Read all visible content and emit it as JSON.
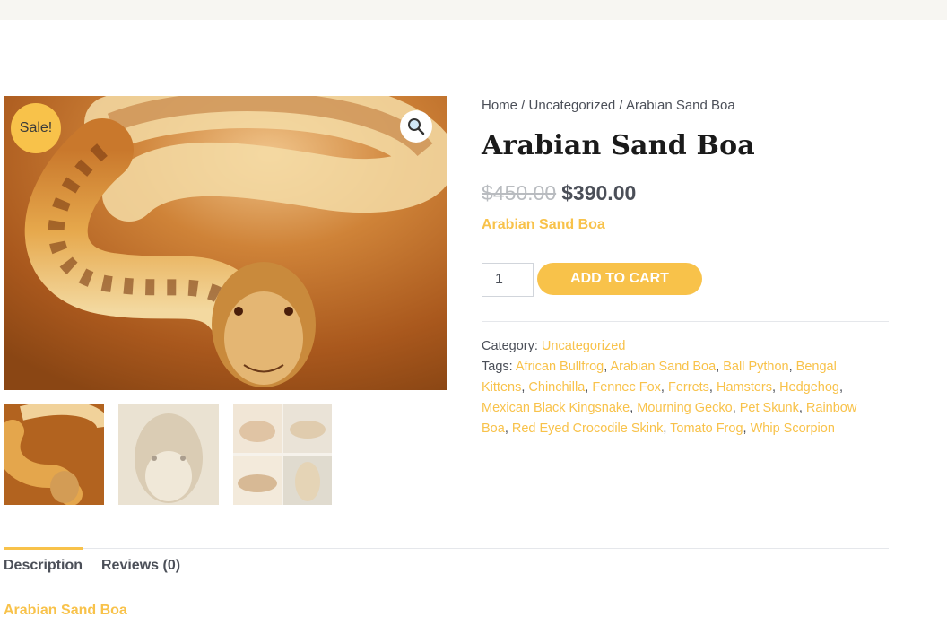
{
  "header": {
    "background": "#f7f6f2"
  },
  "gallery": {
    "sale_badge": "Sale!",
    "zoom_icon": "magnifier-icon",
    "main_image": "snake-on-sand-image",
    "thumbnails": [
      "snake-on-sand-thumbnail",
      "snake-head-closeup-thumbnail",
      "snake-collage-thumbnail"
    ]
  },
  "breadcrumb": {
    "home": "Home",
    "sep1": " / ",
    "category": "Uncategorized",
    "sep2": " / ",
    "current": "Arabian Sand Boa"
  },
  "product": {
    "title": "Arabian Sand Boa",
    "price_old": "$450.00",
    "price_new": "$390.00",
    "short_description": "Arabian Sand Boa",
    "quantity": "1",
    "add_to_cart": "ADD TO CART"
  },
  "meta": {
    "category_label": "Category: ",
    "category": "Uncategorized",
    "tags_label": "Tags: ",
    "tags": [
      "African Bullfrog",
      "Arabian Sand Boa",
      "Ball Python",
      "Bengal Kittens",
      "Chinchilla",
      "Fennec Fox",
      "Ferrets",
      "Hamsters",
      "Hedgehog",
      "Mexican Black Kingsnake",
      "Mourning Gecko",
      "Pet Skunk",
      "Rainbow Boa",
      "Red Eyed Crocodile Skink",
      "Tomato Frog",
      "Whip Scorpion"
    ]
  },
  "tabs": {
    "description": "Description",
    "reviews": "Reviews (0)"
  },
  "description": {
    "heading": "Arabian Sand Boa"
  },
  "colors": {
    "accent": "#f8c24a",
    "text": "#4b4f58",
    "title": "#1a1a1a",
    "muted": "#b9bcc0"
  }
}
